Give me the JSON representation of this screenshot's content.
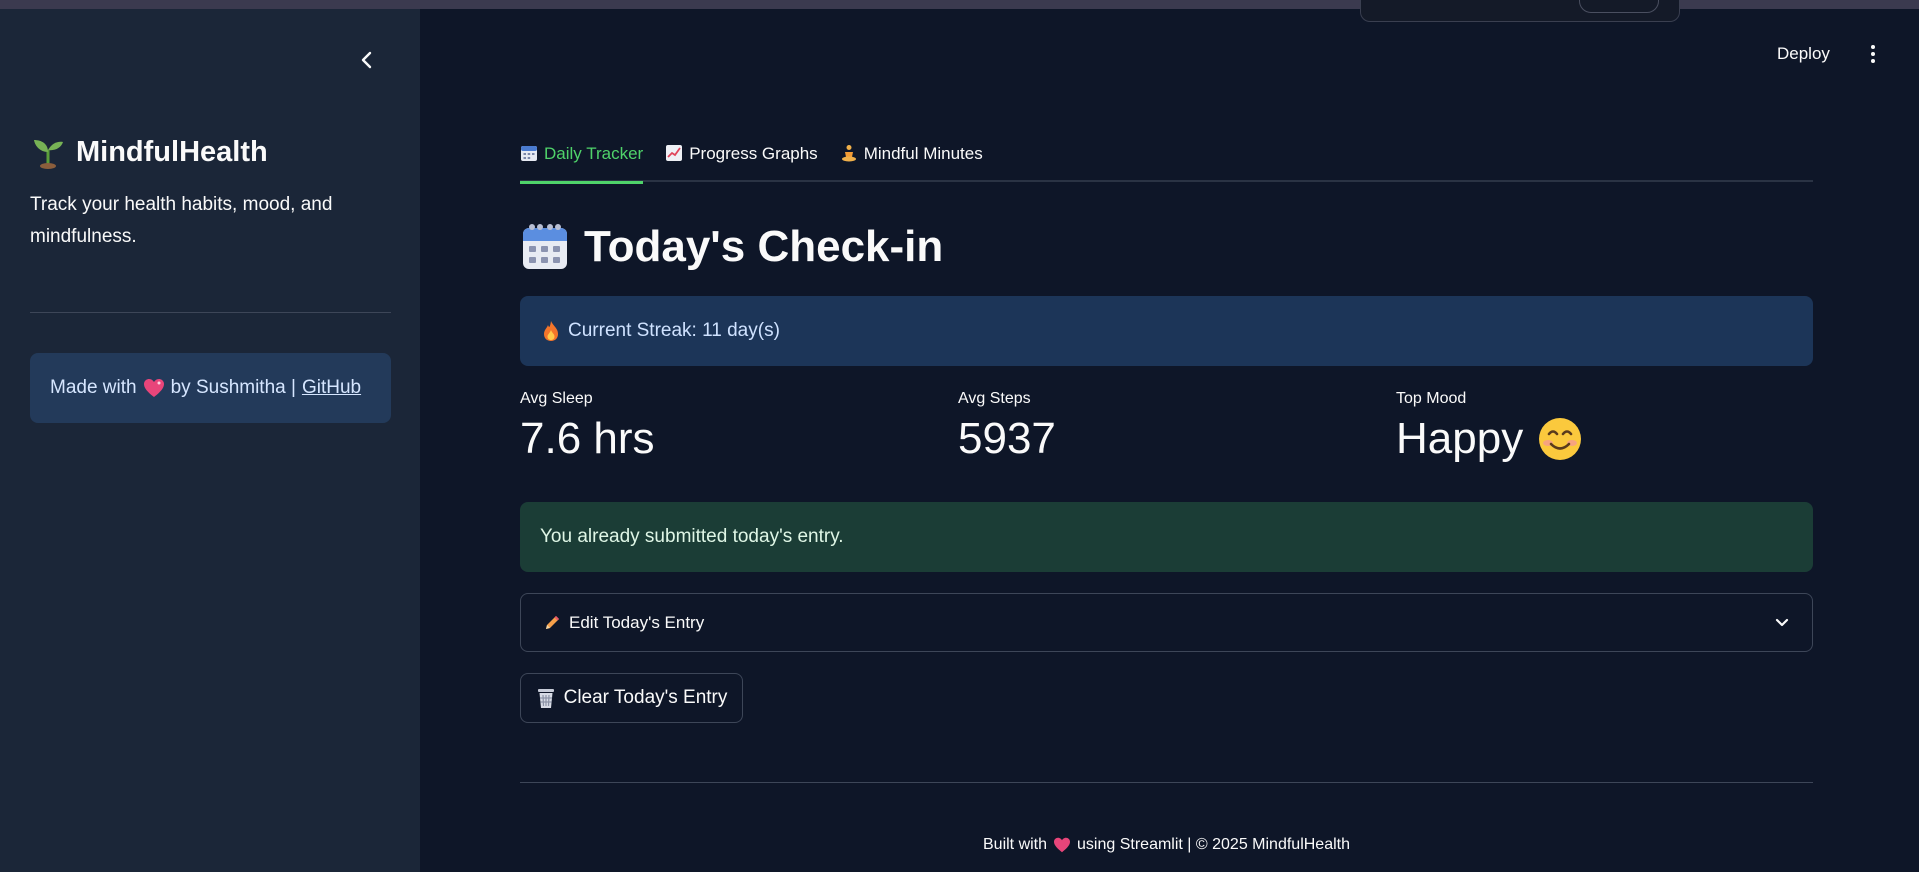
{
  "sidebar": {
    "title": "MindfulHealth",
    "description": "Track your health habits, mood, and mindfulness.",
    "made_with_prefix": "Made with",
    "made_with_by": "by Sushmitha |",
    "github_link": "GitHub"
  },
  "header": {
    "deploy_label": "Deploy"
  },
  "tabs": [
    {
      "label": "Daily Tracker",
      "icon": "calendar-icon",
      "active": true
    },
    {
      "label": "Progress Graphs",
      "icon": "chart-icon",
      "active": false
    },
    {
      "label": "Mindful Minutes",
      "icon": "meditation-icon",
      "active": false
    }
  ],
  "page": {
    "title": "Today's Check-in",
    "streak_text": "Current Streak: 11 day(s)",
    "metrics": [
      {
        "label": "Avg Sleep",
        "value": "7.6 hrs"
      },
      {
        "label": "Avg Steps",
        "value": "5937"
      },
      {
        "label": "Top Mood",
        "value": "Happy"
      }
    ],
    "success_message": "You already submitted today's entry.",
    "expander_label": "Edit Today's Entry",
    "clear_button_label": "Clear Today's Entry"
  },
  "footer": {
    "prefix": "Built with",
    "suffix": "using Streamlit | © 2025 MindfulHealth"
  },
  "colors": {
    "background": "#0e1628",
    "sidebar": "#1b2638",
    "accent_green": "#4fd36a",
    "info_box": "#1c3558",
    "success_box": "#1b3d36"
  }
}
